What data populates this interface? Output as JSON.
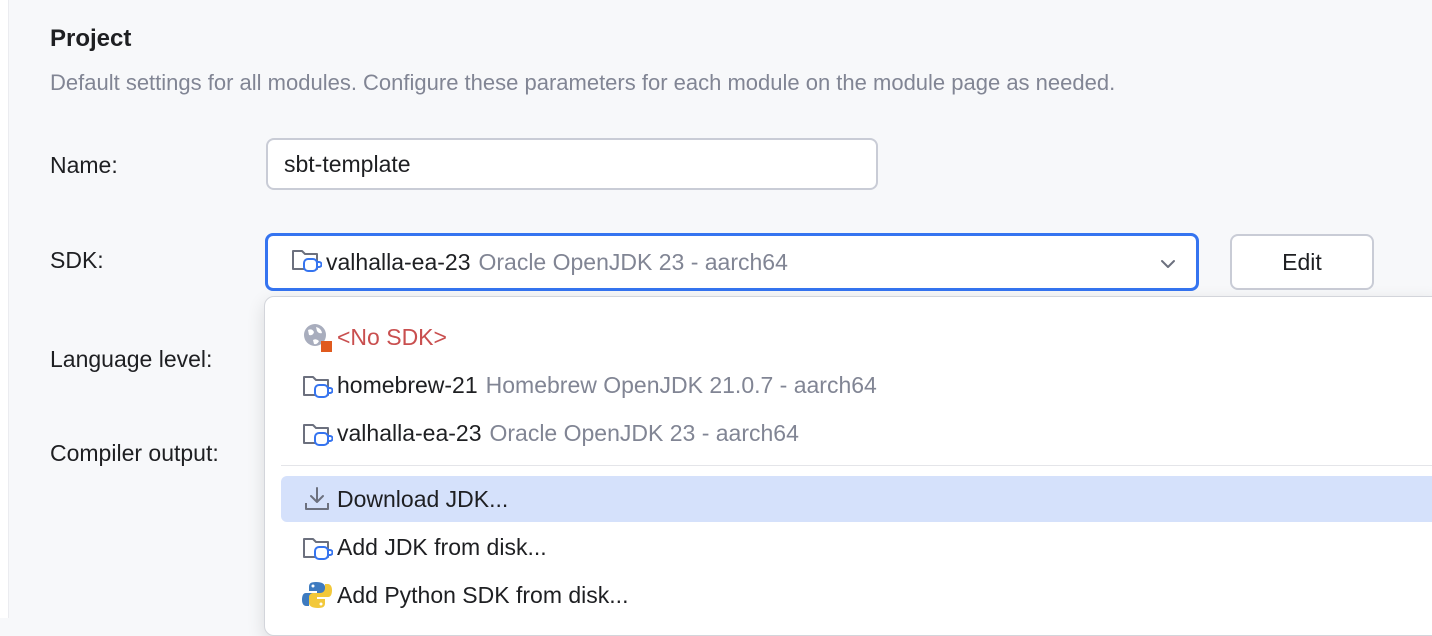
{
  "section": {
    "title": "Project",
    "description": "Default settings for all modules. Configure these parameters for each module on the module page as needed."
  },
  "fields": {
    "name_label": "Name:",
    "name_value": "sbt-template",
    "sdk_label": "SDK:",
    "language_level_label": "Language level:",
    "compiler_output_label": "Compiler output:"
  },
  "sdk_combo": {
    "selected_name": "valhalla-ea-23",
    "selected_detail": "Oracle OpenJDK 23 - aarch64",
    "edit_label": "Edit"
  },
  "dropdown": {
    "items": [
      {
        "name": "<No SDK>",
        "detail": "",
        "icon": "globe-warning-icon"
      },
      {
        "name": "homebrew-21",
        "detail": "Homebrew OpenJDK 21.0.7 - aarch64",
        "icon": "jdk-folder-icon"
      },
      {
        "name": "valhalla-ea-23",
        "detail": "Oracle OpenJDK 23 - aarch64",
        "icon": "jdk-folder-icon"
      }
    ],
    "actions": [
      {
        "label": "Download JDK...",
        "icon": "download-icon",
        "selected": true
      },
      {
        "label": "Add JDK from disk...",
        "icon": "jdk-folder-icon",
        "selected": false
      },
      {
        "label": "Add Python SDK from disk...",
        "icon": "python-icon",
        "selected": false
      }
    ]
  },
  "colors": {
    "accent": "#3574f0",
    "selected_row": "#d5e1fb",
    "no_sdk_text": "#c94f4f",
    "muted_text": "#818594"
  }
}
